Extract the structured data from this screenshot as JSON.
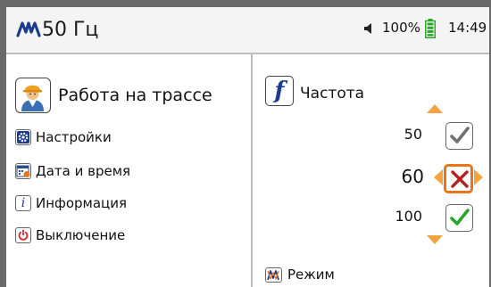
{
  "status_bar": {
    "frequency": "50 Гц",
    "battery_percent": "100%",
    "time": "14:49"
  },
  "left_panel": {
    "title": "Работа на трассе",
    "menu": [
      {
        "label": "Настройки",
        "icon": "gear-icon"
      },
      {
        "label": "Дата и время",
        "icon": "calendar-clock-icon"
      },
      {
        "label": "Информация",
        "icon": "info-icon"
      },
      {
        "label": "Выключение",
        "icon": "power-icon"
      }
    ]
  },
  "right_panel": {
    "title": "Частота",
    "options": [
      {
        "value": "50",
        "state": "checked-gray"
      },
      {
        "value": "60",
        "state": "unchecked-selected"
      },
      {
        "value": "100",
        "state": "checked-green"
      }
    ],
    "mode_label": "Режим"
  },
  "colors": {
    "accent": "#e8741e",
    "wave_blue": "#1e3c8c",
    "check_green": "#2aa52a",
    "check_gray": "#707070",
    "cross_red": "#b52020"
  }
}
